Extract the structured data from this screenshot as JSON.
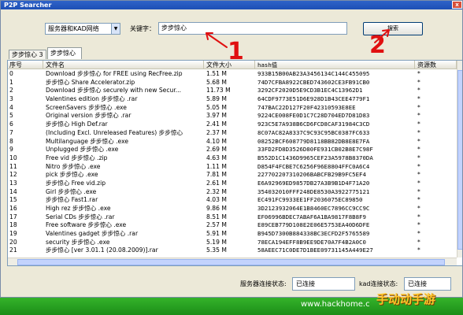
{
  "window": {
    "title": "P2P Searcher",
    "close_glyph": "x"
  },
  "search": {
    "server_select": "服务器和KAD网络",
    "keyword_label": "关键字：",
    "keyword_value": "步步惊心",
    "search_button": "搜索"
  },
  "tabs": [
    {
      "label": "步步惊心 3"
    },
    {
      "label": "步步惊心"
    }
  ],
  "annotations": {
    "one": "1",
    "two": "2",
    "color": "#e01010"
  },
  "table": {
    "headers": [
      "序号",
      "文件名",
      "文件大小",
      "hash值",
      "资源数"
    ],
    "rows": [
      [
        "0",
        "Download 步步惊心 for FREE using RecFree.zip",
        "1.51 M",
        "933B15B00AB23A3456134C144C455095",
        "*"
      ],
      [
        "1",
        "步步惊心 Share Accelerator.zip",
        "5.68 M",
        "74D7CFBA8922CBED743602CE3FB91CB0",
        "*"
      ],
      [
        "2",
        "Download 步步惊心 securely with new Secur...",
        "11.73 M",
        "3292CF2020D5E9CD3B1EC4C13962D1",
        "*"
      ],
      [
        "3",
        "Valentines edition 步步惊心 .rar",
        "5.89 M",
        "64CDF9773E51D6E928D1B43CEE4779F1",
        "*"
      ],
      [
        "4",
        "ScreenSavers 步步惊心 .exe",
        "5.05 M",
        "747BAC22D127F20F42310593E8EE",
        "*"
      ],
      [
        "5",
        "Original version 步步惊心 .rar",
        "3.97 M",
        "9224CE008FE0D1C7C28D704ED7D81D83",
        "*"
      ],
      [
        "6",
        "步步惊心  High Def.rar",
        "2.41 M",
        "923C5E7A938B6CD6FCD8CAF31984C3CD",
        "*"
      ],
      [
        "7",
        "(Including Excl. Unreleased Features) 步步惊心",
        "2.37 M",
        "8C07AC82A8337C9C93C95BC0387FC633",
        "*"
      ],
      [
        "8",
        "Multilanguage 步步惊心 .exe",
        "4.10 M",
        "08252BCF608779D8118BB82DB8E8E7FA",
        "*"
      ],
      [
        "9",
        "Unplugged 步步惊心 .exe",
        "2.69 M",
        "33FD2FD8D3526D80FE931CB02B8E7C98F",
        "*"
      ],
      [
        "10",
        "Free vid 步步惊心 .zip",
        "4.63 M",
        "B552D1C1436D9965CEF23A5978B8370DA",
        "*"
      ],
      [
        "11",
        "Nitro 步步惊心 .exe",
        "1.11 M",
        "D854F4FCBE7C6256F96E8804FFC0A6C4",
        "*"
      ],
      [
        "12",
        "pick 步步惊心 .exe",
        "7.81 M",
        "227702207310206BABCFB29B9FC5EF4",
        "*"
      ],
      [
        "13",
        "步步惊心  Free vid.zip",
        "2.61 M",
        "E6A92969ED9857DB27A3B9B1D4F71A20",
        "*"
      ],
      [
        "14",
        "Girl 步步惊心 .exe",
        "2.32 M",
        "354032010FFF248DE8530A3922775121",
        "*"
      ],
      [
        "15",
        "步步惊心  Fast1.rar",
        "4.03 M",
        "EC491FC9933EE1FF2036075EC89850",
        "*"
      ],
      [
        "16",
        "High rez 步步惊心 .exe",
        "9.86 M",
        "3D2123932064E1B8460EC7896CC9CC9C",
        "*"
      ],
      [
        "17",
        "Serial CDs 步步惊心 .rar",
        "8.51 M",
        "EF06996BDEC7ABAF6A1BA9817F8B8F9",
        "*"
      ],
      [
        "18",
        "Free software 步步惊心 .exe",
        "2.57 M",
        "E89CEB779D108E2E06E5753EA40D6DFE",
        "*"
      ],
      [
        "19",
        "Valentines gadget 步步惊心 .rar",
        "5.91 M",
        "B945D7300B884338BC3ECFD2F5765589",
        "*"
      ],
      [
        "20",
        "security 步步惊心 .exe",
        "5.19 M",
        "78ECA194EFF8B9EE9DE70A7F4B2A0C0",
        "*"
      ],
      [
        "21",
        "步步惊心 [ver 3.01.1 (20.08.2009)].rar",
        "5.35 M",
        "58AEEC71C0DE7D1BEE09731145A449E27",
        "*"
      ]
    ]
  },
  "status": {
    "server_label": "服务器连接状态:",
    "server_value": "已连接",
    "kad_label": "kad连接状态:",
    "kad_value": "已连接"
  },
  "watermark": {
    "url": "www.hackhome.c",
    "logo": "手动动手游"
  }
}
